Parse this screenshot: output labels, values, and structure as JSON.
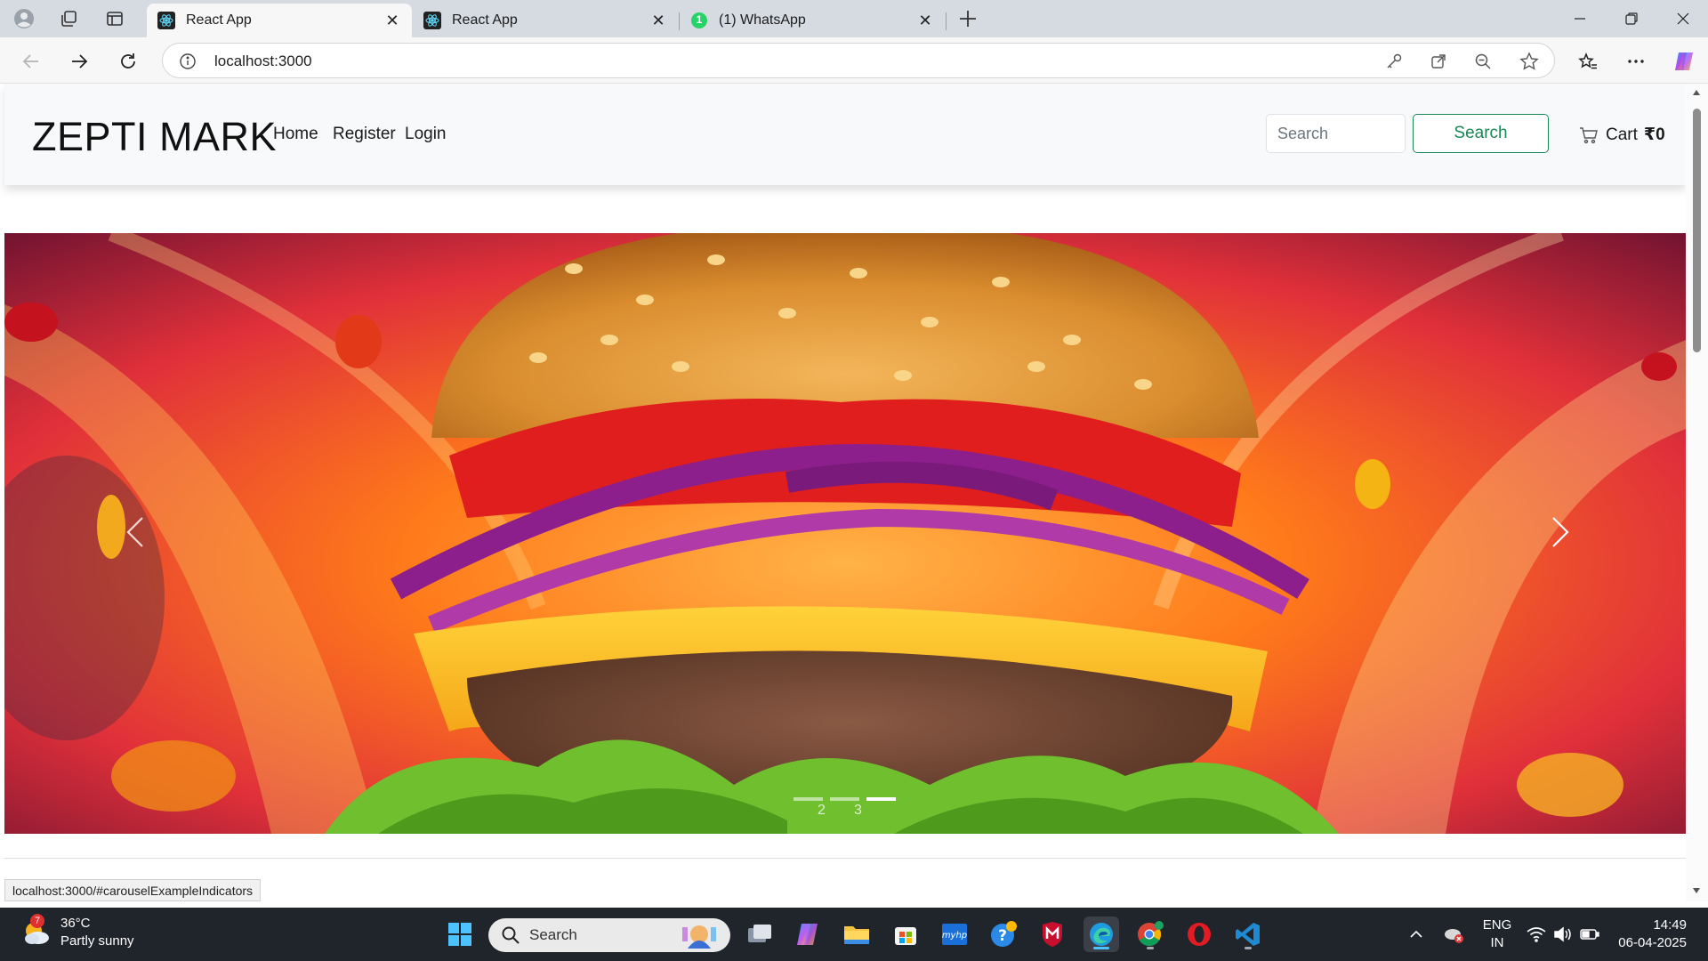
{
  "browser": {
    "tabs": [
      {
        "title": "React App",
        "active": true
      },
      {
        "title": "React App",
        "active": false
      },
      {
        "title": "(1) WhatsApp",
        "active": false
      }
    ],
    "whatsapp_badge": "1",
    "address": "localhost:3000"
  },
  "site": {
    "brand": "ZEPTI MARK",
    "nav": {
      "home": "Home",
      "register": "Register",
      "login": "Login"
    },
    "search": {
      "placeholder": "Search",
      "button": "Search"
    },
    "cart": {
      "label": "Cart",
      "amount": "₹0"
    },
    "carousel": {
      "slide_count": 3,
      "active_index": 2,
      "indicator_labels": [
        "2",
        "3"
      ]
    }
  },
  "status_link": "localhost:3000/#carouselExampleIndicators",
  "taskbar": {
    "weather": {
      "temp": "36°C",
      "condition": "Partly sunny",
      "badge": "7"
    },
    "search_label": "Search",
    "lang": {
      "line1": "ENG",
      "line2": "IN"
    },
    "time": "14:49",
    "date": "06-04-2025"
  },
  "colors": {
    "accent_green": "#198754",
    "tab_strip": "#d6dbe2",
    "taskbar": "#20242b",
    "edge_blue": "#4cc2ff"
  }
}
